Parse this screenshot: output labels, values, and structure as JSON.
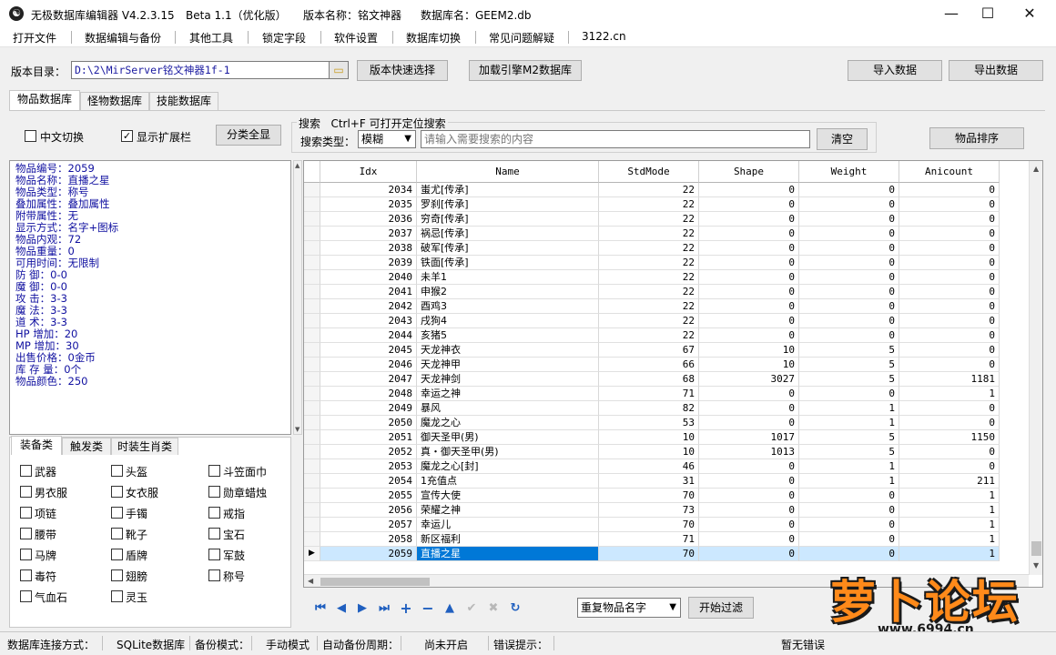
{
  "titlebar": {
    "app": "无极数据库编辑器 V4.2.3.15",
    "build": "Beta 1.1（优化版）",
    "version_name": "版本名称：铭文神器",
    "db_name": "数据库名：GEEM2.db"
  },
  "menu": [
    "打开文件",
    "数据编辑与备份",
    "其他工具",
    "锁定字段",
    "软件设置",
    "数据库切换",
    "常见问题解疑",
    "3122.cn"
  ],
  "toolbar": {
    "dir_label": "版本目录：",
    "dir_value": "D:\\2\\MirServer铭文神器1f-1",
    "quick_select": "版本快速选择",
    "load_engine": "加载引擎M2数据库",
    "import": "导入数据",
    "export": "导出数据"
  },
  "tabs": [
    "物品数据库",
    "怪物数据库",
    "技能数据库"
  ],
  "options": {
    "chinese_switch": "中文切换",
    "chinese_checked": false,
    "show_ext": "显示扩展栏",
    "show_ext_checked": true,
    "show_all": "分类全显"
  },
  "search": {
    "hint": "搜索   Ctrl+F 可打开定位搜索",
    "type_label": "搜索类型：",
    "type_value": "模糊",
    "placeholder": "请输入需要搜索的内容",
    "clear": "清空",
    "sort": "物品排序"
  },
  "info": [
    "物品编号：2059",
    "物品名称：直播之星",
    "物品类型：称号",
    "叠加属性：叠加属性",
    "附带属性：无",
    "显示方式：名字+图标",
    "物品内观：72",
    "物品重量：0",
    "可用时间：无限制",
    "防    御：0-0",
    "魔    御：0-0",
    "攻    击：3-3",
    "魔    法：3-3",
    "道    术：3-3",
    "HP  增加：20",
    "MP  增加：30",
    "出售价格：0金币",
    "库  存  量：0个",
    "物品颜色：250"
  ],
  "category_tabs": [
    "装备类",
    "触发类",
    "时装生肖类"
  ],
  "categories": [
    [
      "武器",
      "头盔",
      "斗笠面巾"
    ],
    [
      "男衣服",
      "女衣服",
      "勋章蜡烛"
    ],
    [
      "项链",
      "手镯",
      "戒指"
    ],
    [
      "腰带",
      "靴子",
      "宝石"
    ],
    [
      "马牌",
      "盾牌",
      "军鼓"
    ],
    [
      "毒符",
      "翅膀",
      "称号"
    ],
    [
      "气血石",
      "灵玉",
      ""
    ]
  ],
  "grid": {
    "columns": [
      "Idx",
      "Name",
      "StdMode",
      "Shape",
      "Weight",
      "Anicount"
    ],
    "rows": [
      [
        "2034",
        "蚩尤[传承]",
        "22",
        "0",
        "0",
        "0"
      ],
      [
        "2035",
        "罗刹[传承]",
        "22",
        "0",
        "0",
        "0"
      ],
      [
        "2036",
        "穷奇[传承]",
        "22",
        "0",
        "0",
        "0"
      ],
      [
        "2037",
        "祸忌[传承]",
        "22",
        "0",
        "0",
        "0"
      ],
      [
        "2038",
        "破军[传承]",
        "22",
        "0",
        "0",
        "0"
      ],
      [
        "2039",
        "铁面[传承]",
        "22",
        "0",
        "0",
        "0"
      ],
      [
        "2040",
        "未羊1",
        "22",
        "0",
        "0",
        "0"
      ],
      [
        "2041",
        "申猴2",
        "22",
        "0",
        "0",
        "0"
      ],
      [
        "2042",
        "酉鸡3",
        "22",
        "0",
        "0",
        "0"
      ],
      [
        "2043",
        "戌狗4",
        "22",
        "0",
        "0",
        "0"
      ],
      [
        "2044",
        "亥猪5",
        "22",
        "0",
        "0",
        "0"
      ],
      [
        "2045",
        "天龙神衣",
        "67",
        "10",
        "5",
        "0"
      ],
      [
        "2046",
        "天龙神甲",
        "66",
        "10",
        "5",
        "0"
      ],
      [
        "2047",
        "天龙神剑",
        "68",
        "3027",
        "5",
        "1181"
      ],
      [
        "2048",
        "幸运之神",
        "71",
        "0",
        "0",
        "1"
      ],
      [
        "2049",
        "暴风",
        "82",
        "0",
        "1",
        "0"
      ],
      [
        "2050",
        "魔龙之心",
        "53",
        "0",
        "1",
        "0"
      ],
      [
        "2051",
        "御天圣甲(男)",
        "10",
        "1017",
        "5",
        "1150"
      ],
      [
        "2052",
        "真・御天圣甲(男)",
        "10",
        "1013",
        "5",
        "0"
      ],
      [
        "2053",
        "魔龙之心[封]",
        "46",
        "0",
        "1",
        "0"
      ],
      [
        "2054",
        "1充值点",
        "31",
        "0",
        "1",
        "211"
      ],
      [
        "2055",
        "宣传大使",
        "70",
        "0",
        "0",
        "1"
      ],
      [
        "2056",
        "荣耀之神",
        "73",
        "0",
        "0",
        "1"
      ],
      [
        "2057",
        "幸运儿",
        "70",
        "0",
        "0",
        "1"
      ],
      [
        "2058",
        "新区福利",
        "71",
        "0",
        "0",
        "1"
      ],
      [
        "2059",
        "直播之星",
        "70",
        "0",
        "0",
        "1"
      ]
    ],
    "selected_index": 25
  },
  "bottom": {
    "filter_value": "重复物品名字",
    "start_filter": "开始过滤"
  },
  "status": {
    "conn_label": "数据库连接方式：",
    "conn_value": "SQLite数据库",
    "backup_label": "备份模式：",
    "backup_value": "手动模式",
    "auto_label": "自动备份周期：",
    "auto_value": "尚未开启",
    "error_label": "错误提示：",
    "error_value": "暂无错误"
  },
  "watermark": {
    "text": "萝卜论坛",
    "url": "www.6994.cn"
  }
}
